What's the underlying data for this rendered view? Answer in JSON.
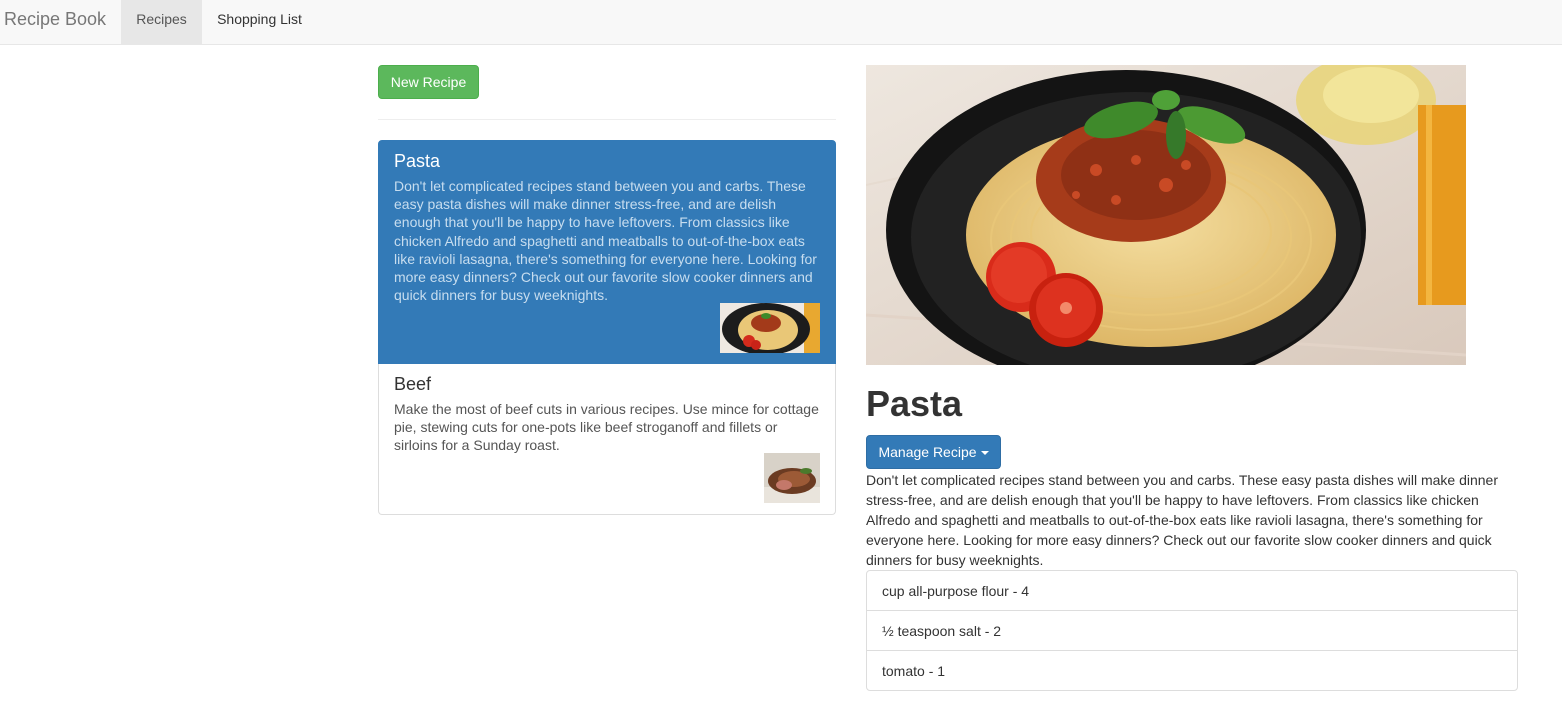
{
  "navbar": {
    "brand": "Recipe Book",
    "tabs": [
      {
        "label": "Recipes",
        "active": true
      },
      {
        "label": "Shopping List",
        "active": false
      }
    ]
  },
  "recipe_list": {
    "new_button_label": "New Recipe",
    "items": [
      {
        "name": "Pasta",
        "description": "Don't let complicated recipes stand between you and carbs. These easy pasta dishes will make dinner stress-free, and are delish enough that you'll be happy to have leftovers. From classics like chicken Alfredo and spaghetti and meatballs to out-of-the-box eats like ravioli lasagna, there's something for everyone here. Looking for more easy dinners? Check out our favorite slow cooker dinners and quick dinners for busy weeknights.",
        "selected": true,
        "thumbnail": "pasta-thumbnail"
      },
      {
        "name": "Beef",
        "description": "Make the most of beef cuts in various recipes. Use mince for cottage pie, stewing cuts for one-pots like beef stroganoff and fillets or sirloins for a Sunday roast.",
        "selected": false,
        "thumbnail": "beef-thumbnail"
      }
    ]
  },
  "detail": {
    "title": "Pasta",
    "manage_button_label": "Manage Recipe",
    "description": "Don't let complicated recipes stand between you and carbs. These easy pasta dishes will make dinner stress-free, and are delish enough that you'll be happy to have leftovers. From classics like chicken Alfredo and spaghetti and meatballs to out-of-the-box eats like ravioli lasagna, there's something for everyone here. Looking for more easy dinners? Check out our favorite slow cooker dinners and quick dinners for busy weeknights.",
    "ingredients": [
      "cup all-purpose flour - 4",
      "½ teaspoon salt - 2",
      "tomato - 1"
    ]
  },
  "colors": {
    "success": "#5cb85c",
    "primary": "#337ab7",
    "navbar_bg": "#f8f8f8"
  }
}
